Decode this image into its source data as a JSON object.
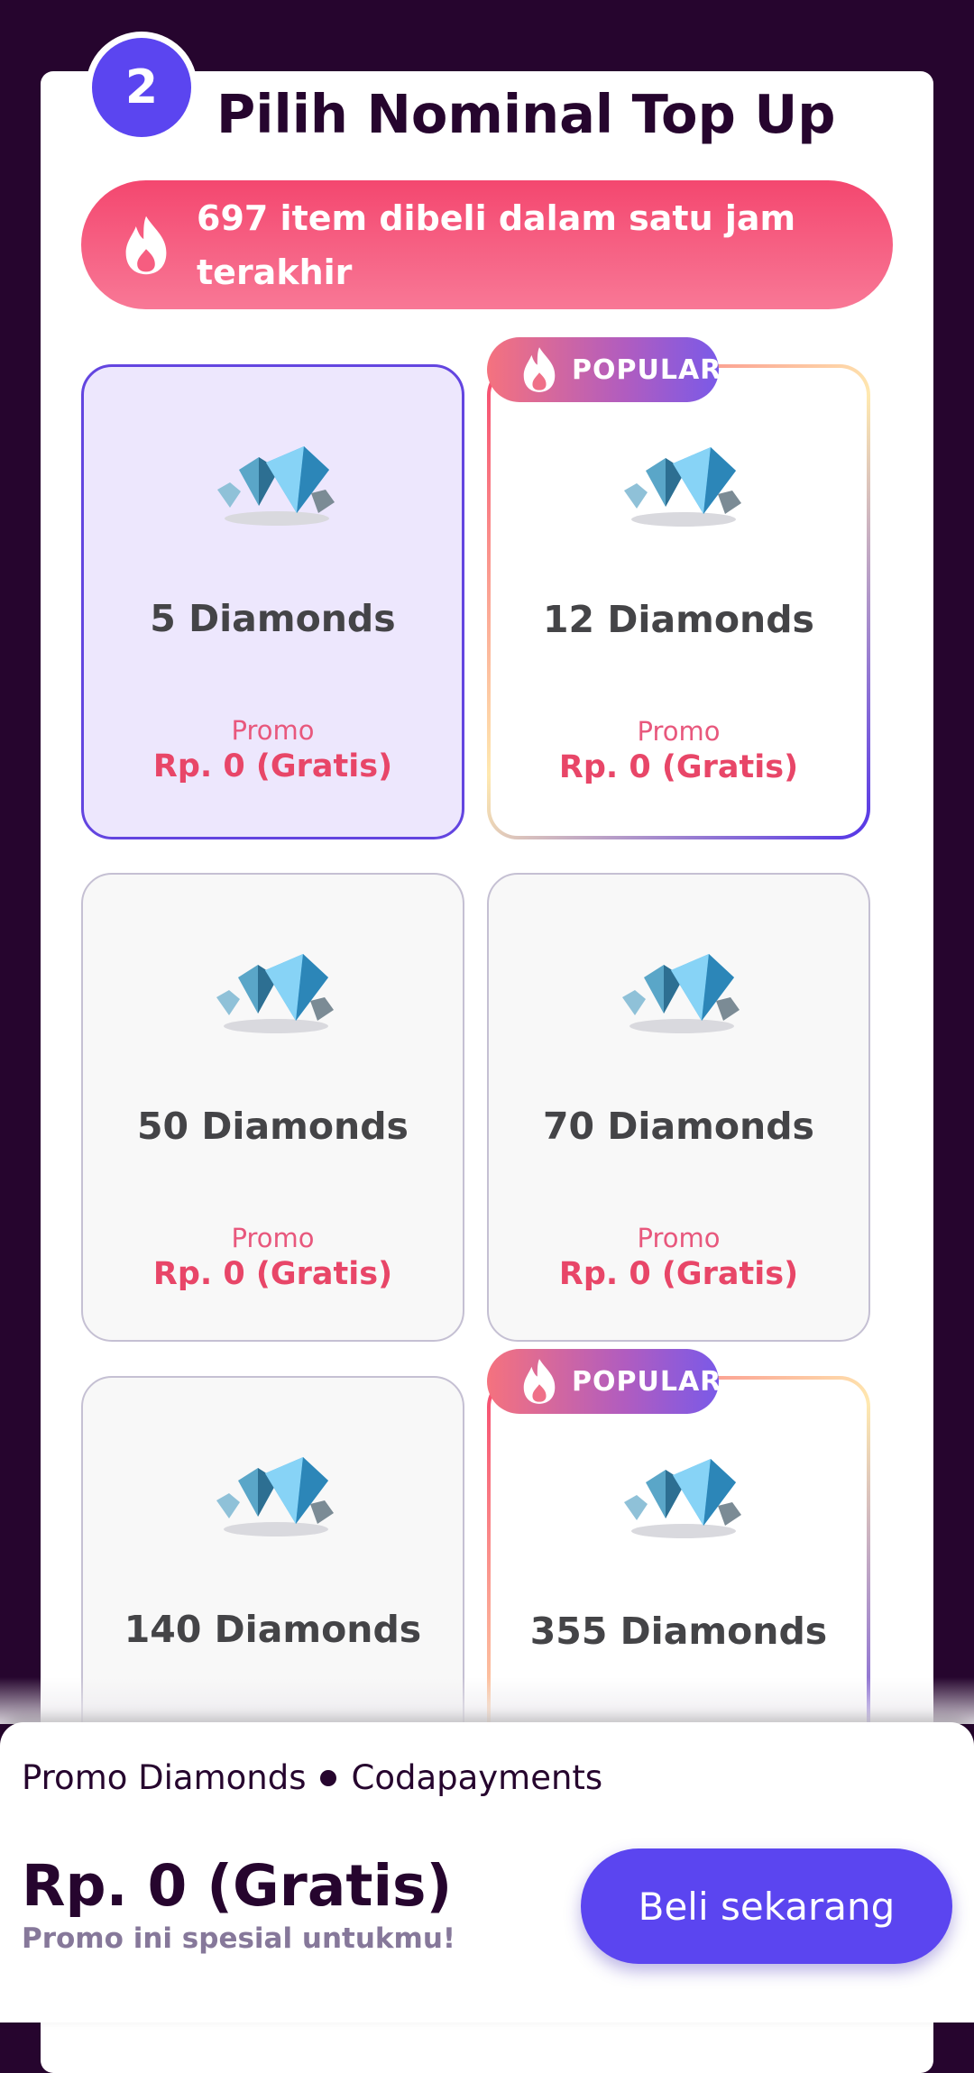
{
  "section": {
    "step_number": "2",
    "title": "Pilih Nominal Top Up"
  },
  "banner": {
    "icon": "flame-icon",
    "text": "697 item dibeli dalam satu jam terakhir"
  },
  "popular_badge_label": "POPULAR",
  "items": [
    {
      "name": "5 Diamonds",
      "promo": "Promo",
      "price": "Rp. 0 (Gratis)",
      "state": "selected",
      "popular": false
    },
    {
      "name": "12 Diamonds",
      "promo": "Promo",
      "price": "Rp. 0 (Gratis)",
      "state": "default",
      "popular": true
    },
    {
      "name": "50 Diamonds",
      "promo": "Promo",
      "price": "Rp. 0 (Gratis)",
      "state": "default",
      "popular": false
    },
    {
      "name": "70 Diamonds",
      "promo": "Promo",
      "price": "Rp. 0 (Gratis)",
      "state": "default",
      "popular": false
    },
    {
      "name": "140 Diamonds",
      "promo": "",
      "price": "",
      "state": "default",
      "popular": false
    },
    {
      "name": "355 Diamonds",
      "promo": "",
      "price": "",
      "state": "default",
      "popular": true
    }
  ],
  "checkout": {
    "product": "Promo Diamonds",
    "provider": "Codapayments",
    "total": "Rp. 0 (Gratis)",
    "note": "Promo ini spesial untukmu!",
    "buy_label": "Beli sekarang"
  },
  "colors": {
    "background": "#26052e",
    "accent": "#5b45f0",
    "banner": "#f4476f",
    "price": "#e84668"
  }
}
